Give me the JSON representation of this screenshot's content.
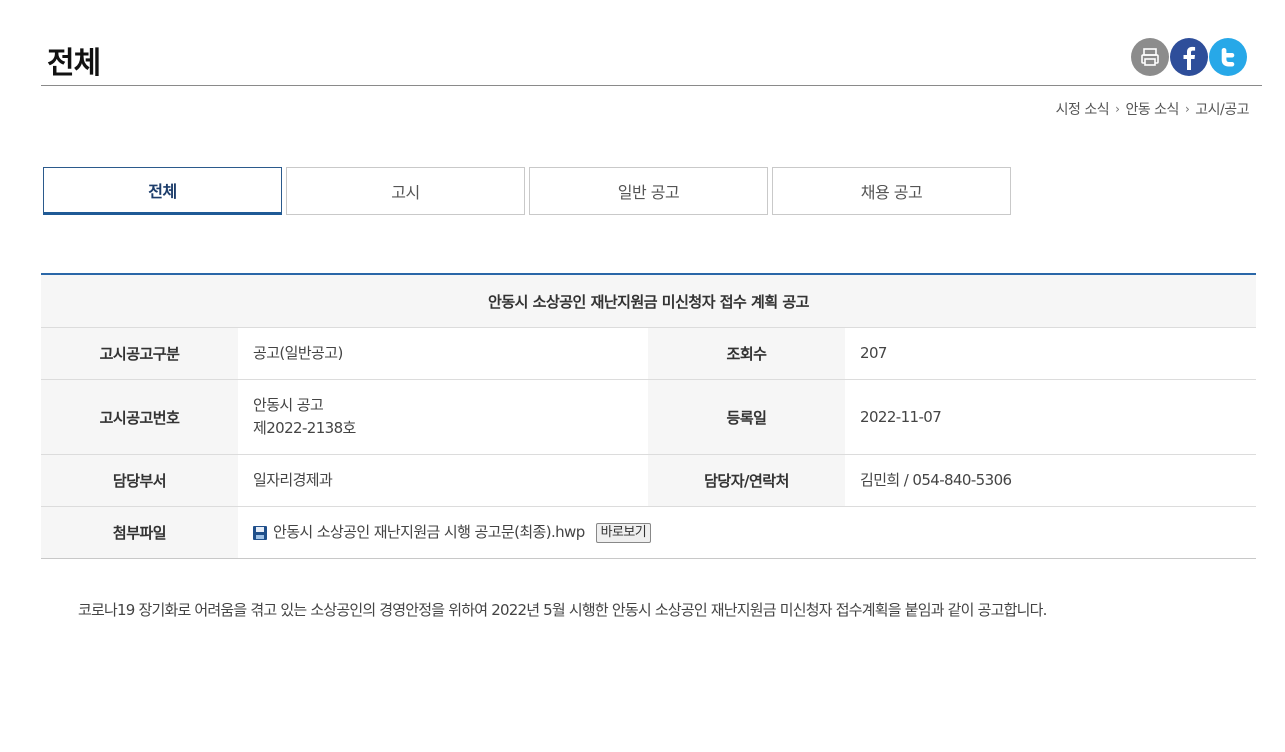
{
  "header": {
    "title": "전체"
  },
  "share": {
    "print_icon": "print-icon",
    "facebook_icon": "facebook-icon",
    "twitter_icon": "twitter-icon"
  },
  "breadcrumb": [
    "시정 소식",
    "안동 소식",
    "고시/공고"
  ],
  "tabs": [
    {
      "label": "전체",
      "active": true
    },
    {
      "label": "고시",
      "active": false
    },
    {
      "label": "일반 공고",
      "active": false
    },
    {
      "label": "채용 공고",
      "active": false
    }
  ],
  "notice": {
    "title": "안동시 소상공인 재난지원금 미신청자 접수 계획 공고",
    "category_label": "고시공고구분",
    "category_value": "공고(일반공고)",
    "views_label": "조회수",
    "views_value": "207",
    "number_label": "고시공고번호",
    "number_value_line1": "안동시 공고",
    "number_value_line2": "제2022-2138호",
    "date_label": "등록일",
    "date_value": "2022-11-07",
    "dept_label": "담당부서",
    "dept_value": "일자리경제과",
    "contact_label": "담당자/연락처",
    "contact_value": "김민희 / 054-840-5306",
    "attach_label": "첨부파일",
    "attach_file": "안동시 소상공인 재난지원금 시행 공고문(최종).hwp",
    "attach_view": "바로보기",
    "body": "코로나19 장기화로 어려움을 겪고 있는 소상공인의 경영안정을 위하여 2022년 5월 시행한 안동시 소상공인 재난지원금 미신청자 접수계획을 붙임과 같이 공고합니다."
  },
  "colors": {
    "accent": "#2a67a8",
    "tab_active": "#1f5a96",
    "facebook": "#2e4e9a",
    "twitter": "#27a8e8",
    "print": "#8c8c8c"
  }
}
